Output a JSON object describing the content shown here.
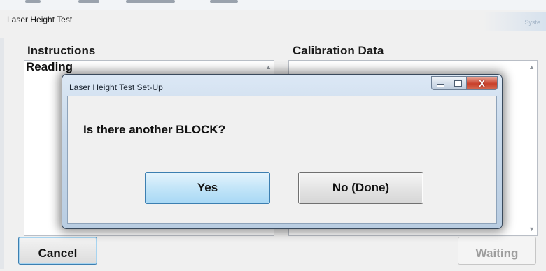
{
  "main_window": {
    "title": "Laser Height Test",
    "title_right_fragment": "Syste",
    "instructions_label": "Instructions",
    "instructions_text": "Reading",
    "calibration_label": "Calibration Data",
    "cancel_label": "Cancel",
    "waiting_label": "Waiting",
    "scroll_up_glyph": "▲",
    "scroll_down_glyph": "▼"
  },
  "dialog": {
    "title": "Laser Height Test Set-Up",
    "question": "Is there another BLOCK?",
    "yes_label": "Yes",
    "no_label": "No (Done)",
    "close_glyph": "X"
  },
  "colors": {
    "dialog_frame": "#c7d8ea",
    "close_button": "#c8402a",
    "default_button": "#a8d8f5",
    "window_bg": "#f0f0f0"
  }
}
